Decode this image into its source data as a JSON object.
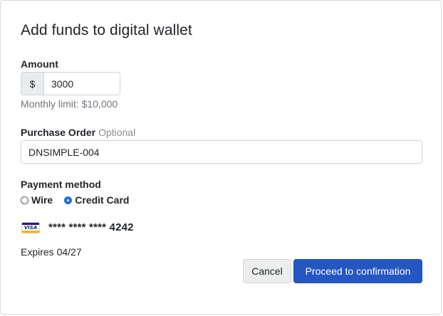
{
  "dialog": {
    "title": "Add funds to digital wallet"
  },
  "amount": {
    "label": "Amount",
    "currency_symbol": "$",
    "value": "3000",
    "help_text": "Monthly limit: $10,000"
  },
  "purchase_order": {
    "label": "Purchase Order",
    "optional_text": "Optional",
    "value": "DNSIMPLE-004"
  },
  "payment_method": {
    "label": "Payment method",
    "options": [
      {
        "label": "Wire",
        "selected": false
      },
      {
        "label": "Credit Card",
        "selected": true
      }
    ]
  },
  "card": {
    "brand_icon": "visa-card-icon",
    "brand_text": "VISA",
    "masked_number": "**** **** **** 4242",
    "expires": "Expires 04/27"
  },
  "actions": {
    "cancel_label": "Cancel",
    "proceed_label": "Proceed to confirmation"
  },
  "colors": {
    "primary": "#2557c2",
    "radio_accent": "#1f6fe5",
    "muted_text": "#6c757d"
  }
}
